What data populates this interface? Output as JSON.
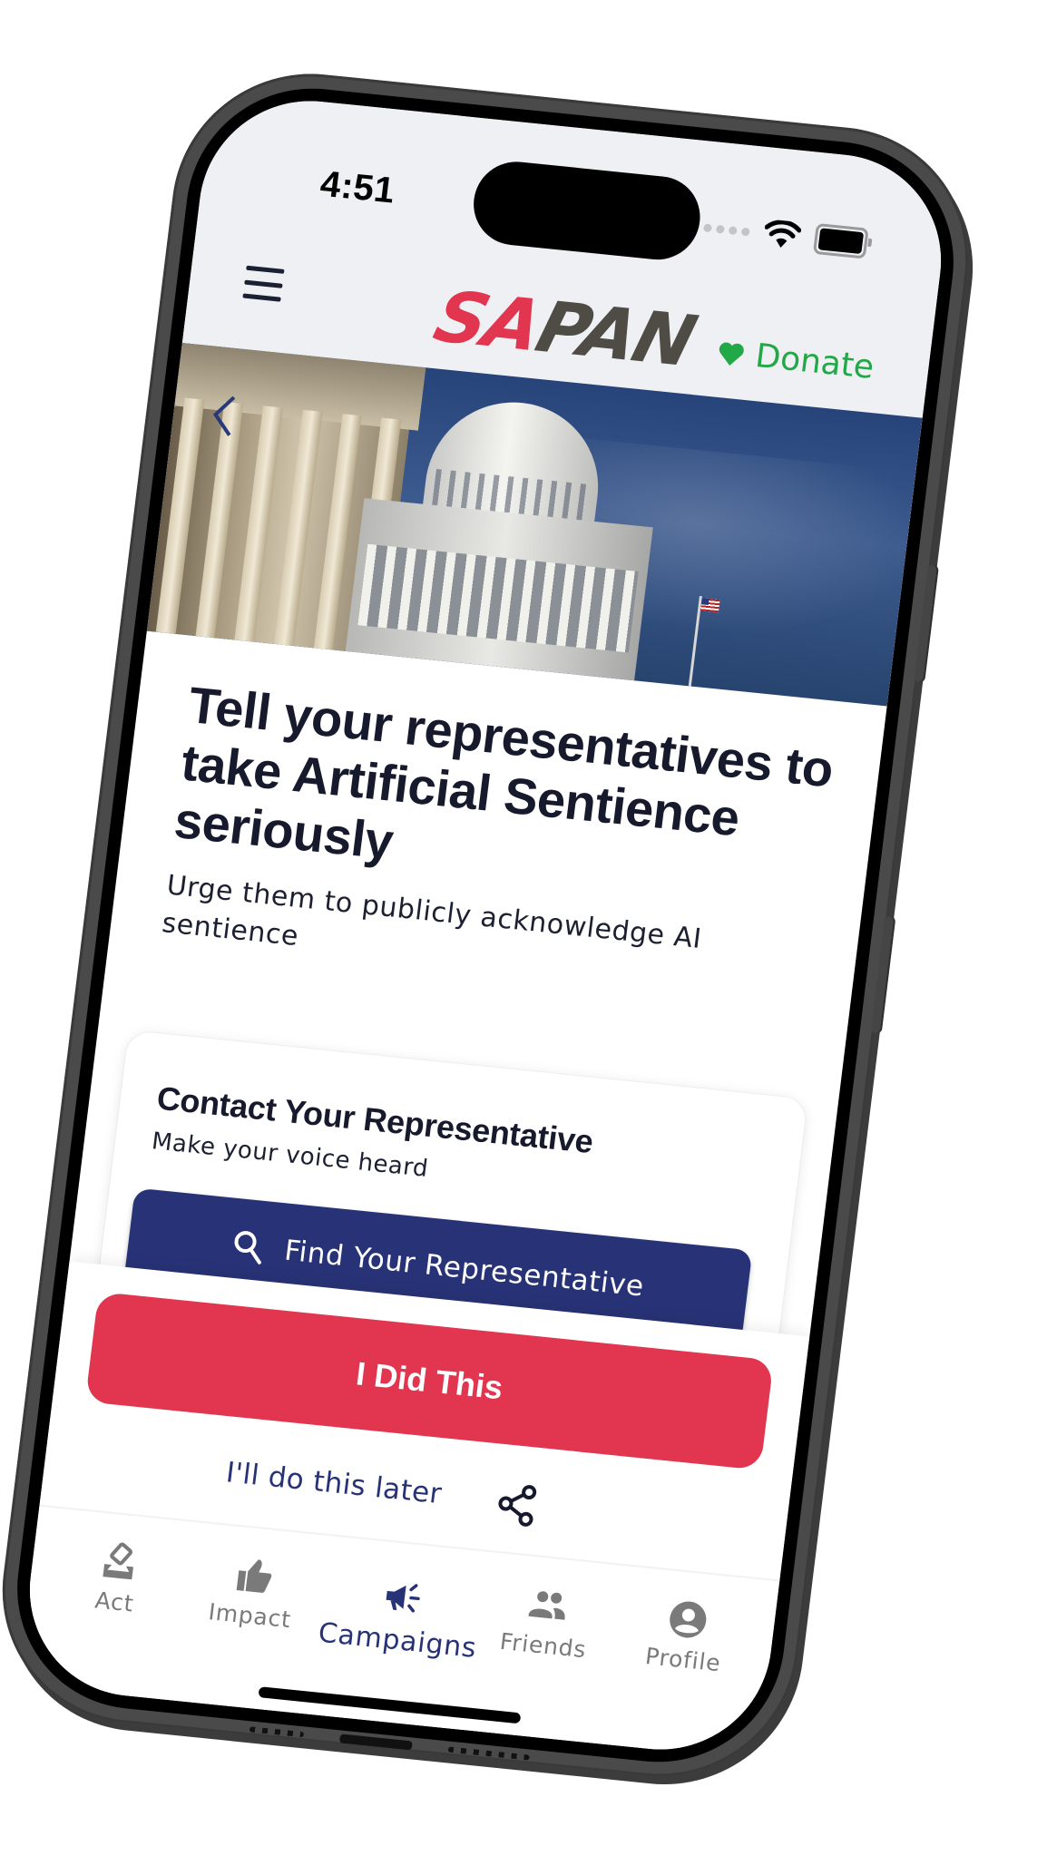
{
  "status_bar": {
    "time": "4:51",
    "signal_icon": "cellular-signal-icon",
    "wifi_icon": "wifi-icon",
    "battery_icon": "battery-icon"
  },
  "header": {
    "menu_icon": "hamburger-menu-icon",
    "logo": {
      "part1": "SA",
      "part2": "PAN"
    },
    "donate": {
      "icon": "heart-icon",
      "label": "Donate"
    }
  },
  "hero": {
    "image": "us-capitol-building-photo",
    "back_icon": "chevron-left-icon"
  },
  "campaign": {
    "title": "Tell your representatives to take Artificial Sentience seriously",
    "subtitle": "Urge them to publicly acknowledge AI sentience"
  },
  "contact_card": {
    "title": "Contact Your Representative",
    "subtitle": "Make your voice heard",
    "button": {
      "icon": "search-icon",
      "label": "Find Your Representative"
    }
  },
  "actions": {
    "primary": "I Did This",
    "secondary": "I'll do this later",
    "share_icon": "share-icon"
  },
  "tabbar": {
    "items": [
      {
        "label": "Act",
        "icon": "ballot-box-icon",
        "active": false
      },
      {
        "label": "Impact",
        "icon": "thumbs-up-icon",
        "active": false
      },
      {
        "label": "Campaigns",
        "icon": "megaphone-icon",
        "active": true
      },
      {
        "label": "Friends",
        "icon": "people-icon",
        "active": false
      },
      {
        "label": "Profile",
        "icon": "user-circle-icon",
        "active": false
      }
    ]
  },
  "colors": {
    "brand_red": "#e23650",
    "brand_navy": "#283377",
    "brand_gray": "#4f4b45",
    "donate_green": "#22a846",
    "header_bg": "#eff0f4",
    "tab_inactive": "#7a7a7a"
  }
}
